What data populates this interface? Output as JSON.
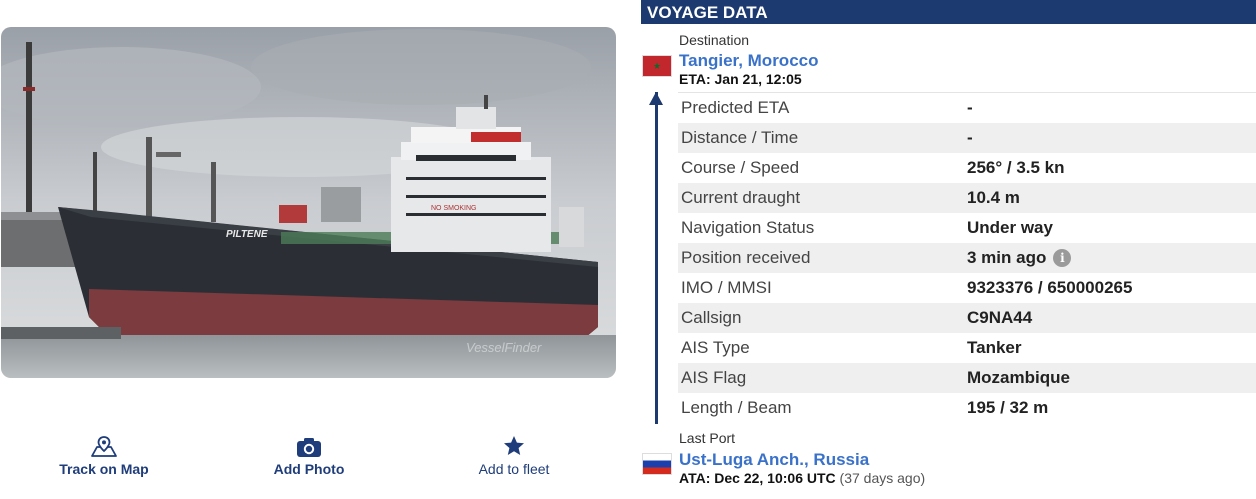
{
  "photo": {
    "alt": "PILTENE",
    "hull_name": "PILTENE",
    "superstructure_text": "NO SMOKING",
    "watermark": "VesselFinder"
  },
  "actions": [
    {
      "label": "Track on Map",
      "icon": "map-pin-icon"
    },
    {
      "label": "Add Photo",
      "icon": "camera-icon"
    },
    {
      "label": "Add to fleet",
      "icon": "star-icon"
    }
  ],
  "voyage": {
    "title": "VOYAGE DATA",
    "destination": {
      "label": "Destination",
      "port": "Tangier, Morocco",
      "eta": "ETA: Jan 21, 12:05",
      "flag_icon": "morocco-flag-icon"
    },
    "rows": [
      {
        "key": "Predicted ETA",
        "value": "-"
      },
      {
        "key": "Distance / Time",
        "value": "-"
      },
      {
        "key": "Course / Speed",
        "value": "256° / 3.5 kn"
      },
      {
        "key": "Current draught",
        "value": "10.4 m"
      },
      {
        "key": "Navigation Status",
        "value": "Under way"
      },
      {
        "key": "Position received",
        "value": "3 min ago",
        "info_icon": "i"
      },
      {
        "key": "IMO / MMSI",
        "value": "9323376 / 650000265"
      },
      {
        "key": "Callsign",
        "value": "C9NA44"
      },
      {
        "key": "AIS Type",
        "value": "Tanker"
      },
      {
        "key": "AIS Flag",
        "value": "Mozambique"
      },
      {
        "key": "Length / Beam",
        "value": "195 / 32 m"
      }
    ],
    "last_port": {
      "label": "Last Port",
      "port": "Ust-Luga Anch., Russia",
      "ata": "ATA: Dec 22, 10:06 UTC",
      "ago": "(37 days ago)",
      "flag_icon": "russia-flag-icon"
    }
  },
  "colors": {
    "header_bg": "#1d3a70",
    "link": "#3a72c9",
    "row_alt": "#efefef",
    "action_text": "#1f3d7a"
  }
}
